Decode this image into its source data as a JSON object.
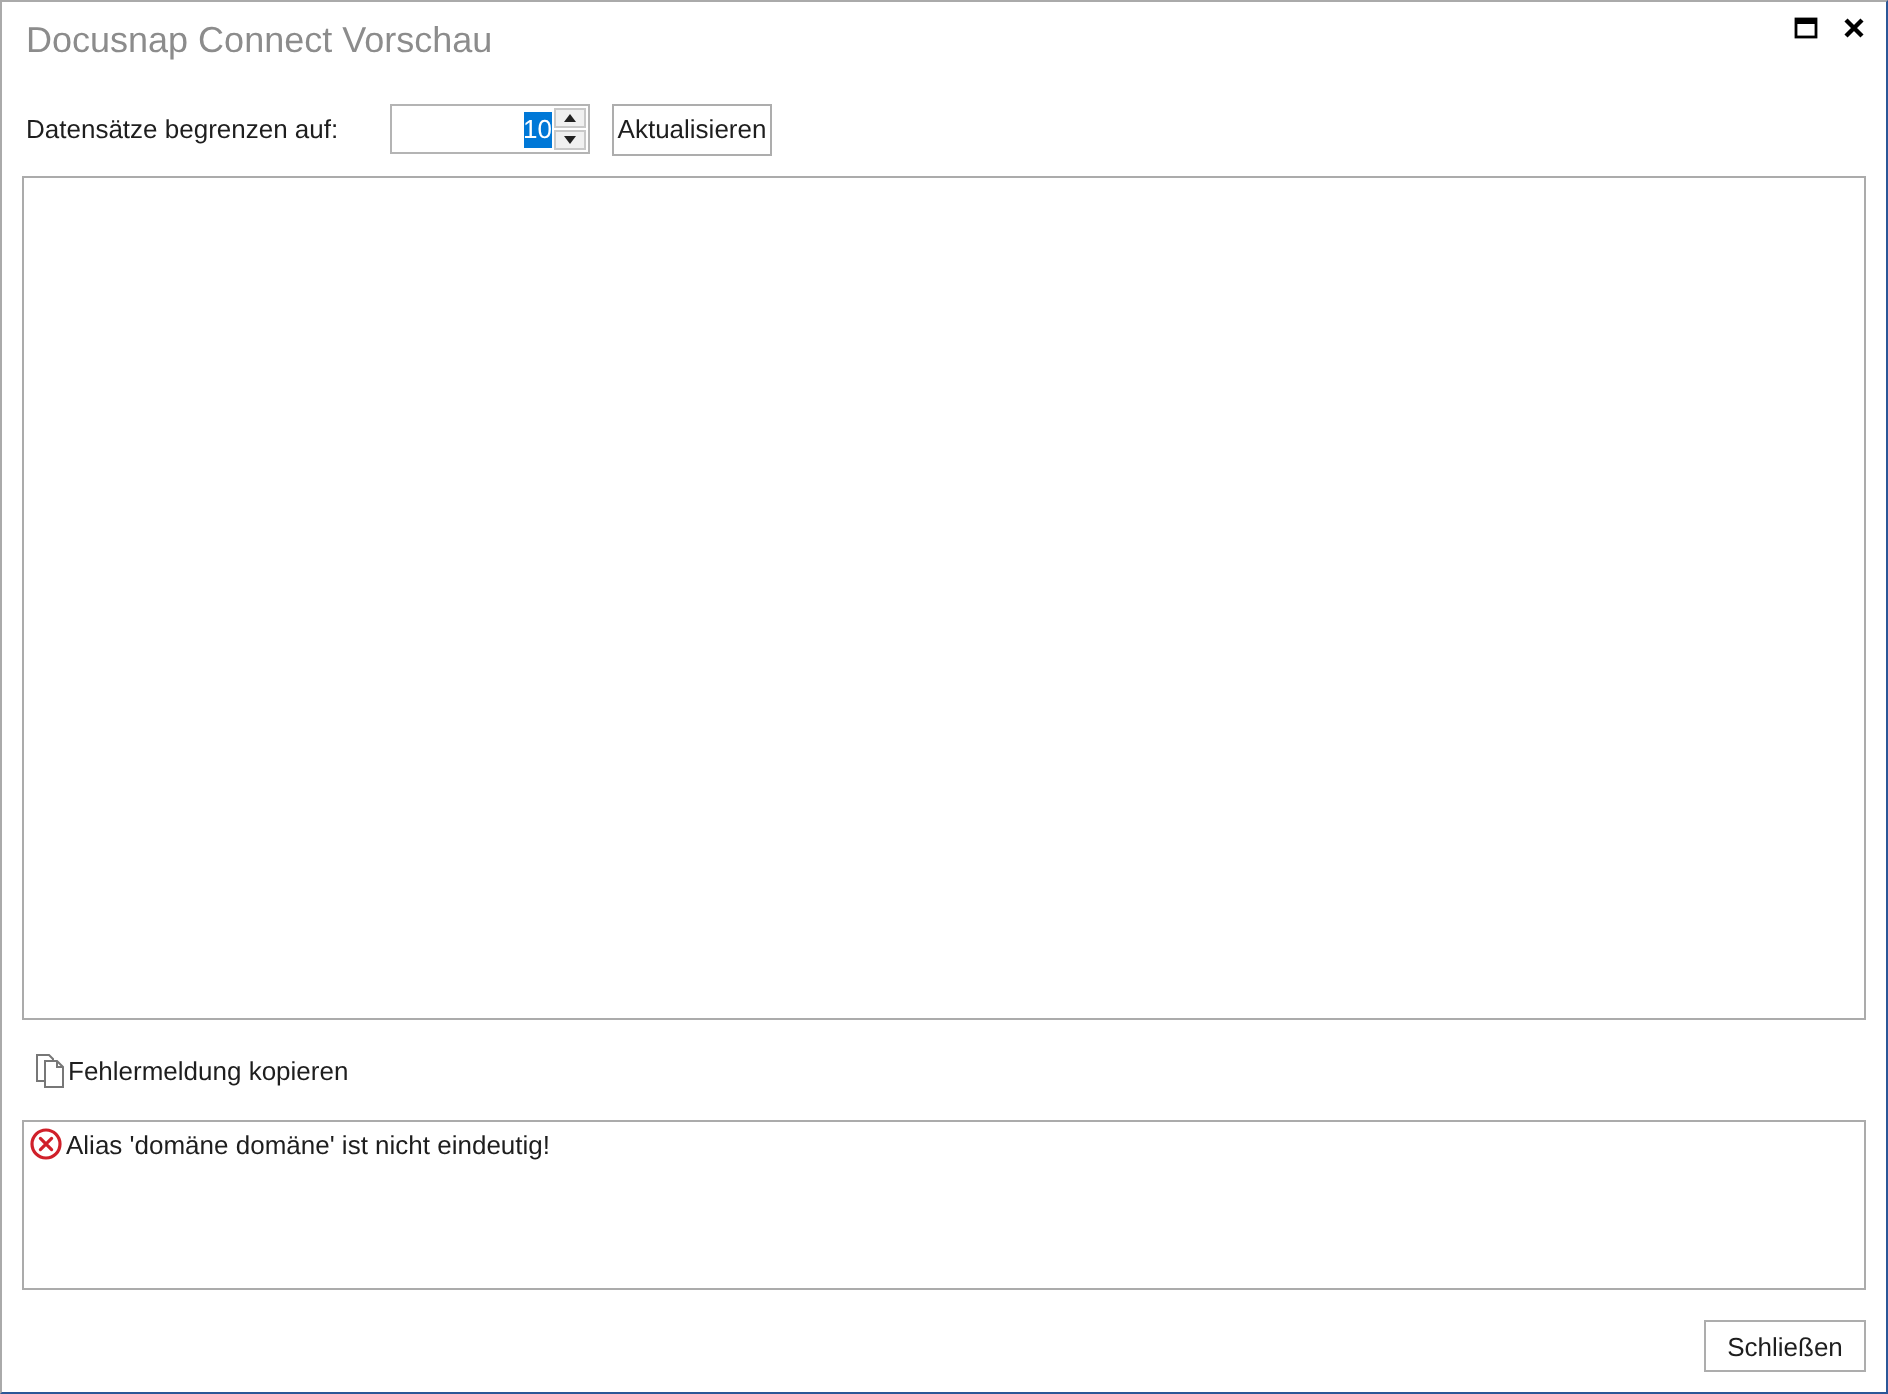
{
  "window": {
    "title": "Docusnap Connect Vorschau"
  },
  "toolbar": {
    "limit_label": "Datensätze begrenzen auf:",
    "limit_field": {
      "value": "10",
      "value_selected": true
    },
    "refresh_button": "Aktualisieren"
  },
  "copy_error_link": "Fehlermeldung kopieren",
  "messages": [
    {
      "kind": "error",
      "text": "Alias 'domäne domäne' ist nicht eindeutig!"
    }
  ],
  "buttons": [
    "Schließen"
  ]
}
